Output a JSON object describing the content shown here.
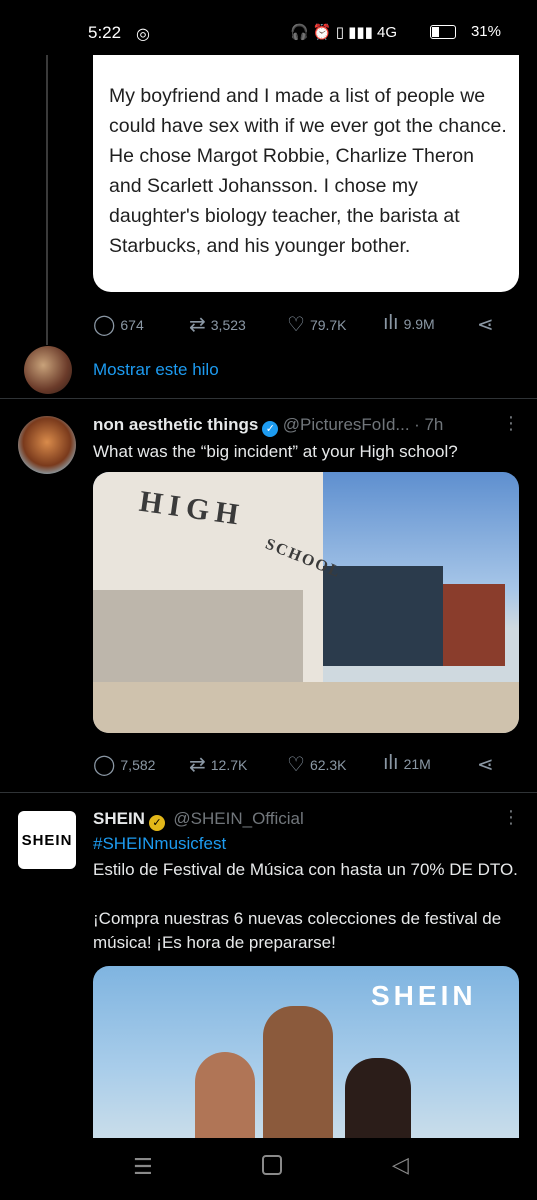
{
  "status": {
    "time": "5:22",
    "battery": "31%",
    "icons_right": "🎧 ⏰ ▯ ▮▮▮ 4G"
  },
  "tweet1": {
    "text": "My boyfriend and I made a list of people we could have sex with if we ever got the chance. He chose Margot Robbie, Charlize Theron and Scarlett Johansson. I chose my daughter's biology teacher, the barista at Starbucks, and his younger bother.",
    "replies": "674",
    "retweets": "3,523",
    "likes": "79.7K",
    "views": "9.9M",
    "show_thread": "Mostrar este hilo"
  },
  "tweet2": {
    "name": "non aesthetic things",
    "handle": "@PicturesFoId...",
    "time": "· 7h",
    "text": "What was the “big incident” at your High school?",
    "building_sign_left": "HIGH",
    "building_sign_right": "SCHOOL",
    "replies": "7,582",
    "retweets": "12.7K",
    "likes": "62.3K",
    "views": "21M"
  },
  "tweet3": {
    "name": "SHEIN",
    "handle": "@SHEIN_Official",
    "avatar_text": "SHEIN",
    "hashtag": "#SHEINmusicfest",
    "line1": "Estilo de Festival de Música con hasta un 70% DE DTO.",
    "line2": "¡Compra nuestras 6 nuevas colecciones de festival de música! ¡Es hora de prepararse!",
    "ad_logo": "SHEIN"
  },
  "icons": {
    "reply": "reply-icon",
    "retweet": "retweet-icon",
    "like": "heart-icon",
    "views": "views-icon",
    "share": "share-icon",
    "more": "more-icon"
  },
  "colors": {
    "link": "#1d9bf0",
    "verified_blue": "#1d9bf0",
    "verified_gold": "#e2b719",
    "muted": "#71767b"
  }
}
